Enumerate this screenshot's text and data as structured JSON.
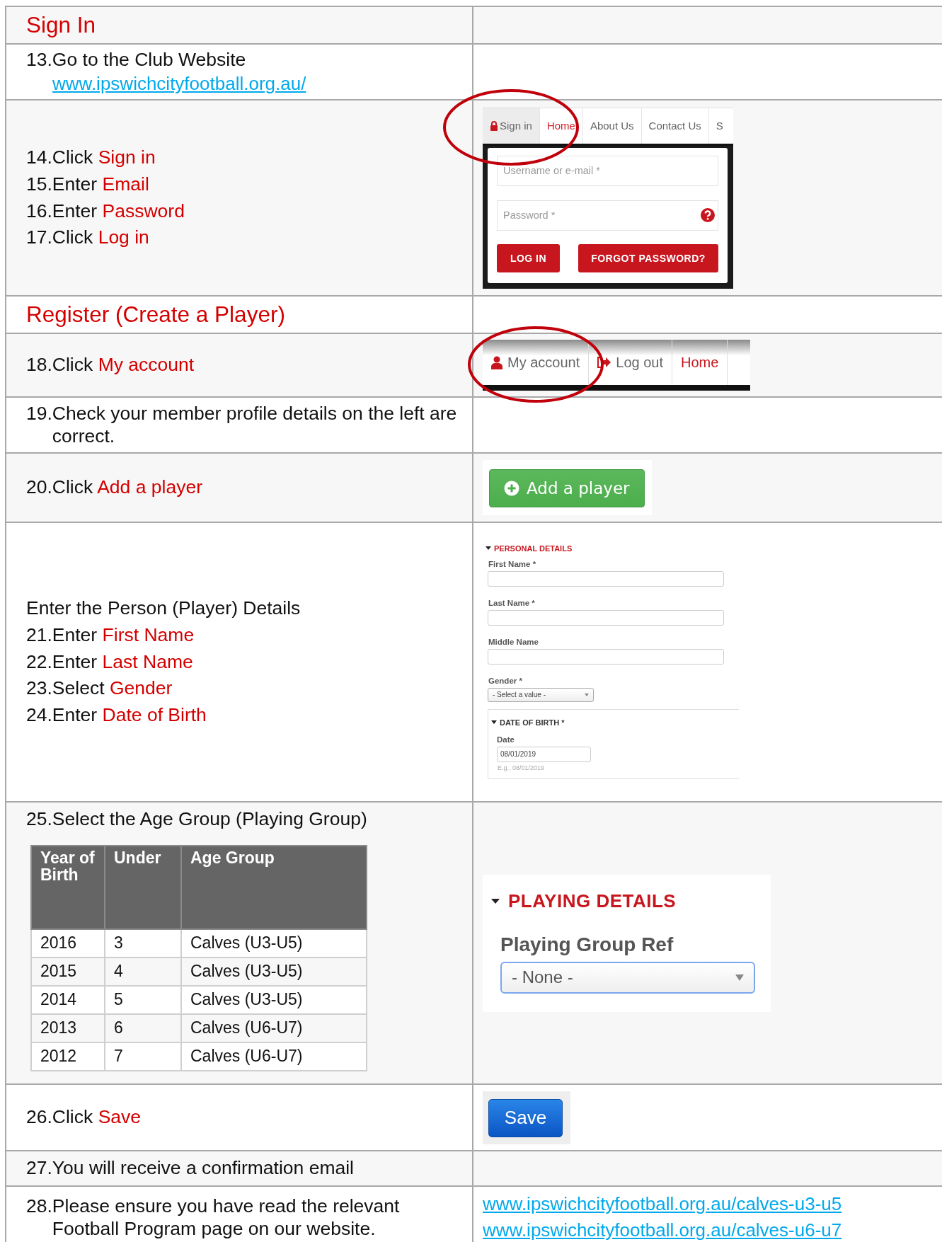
{
  "sections": [
    {
      "kind": "heading",
      "title": "Sign In"
    },
    {
      "kind": "step",
      "steps": [
        {
          "number": "13.",
          "text": "Go to the Club Website"
        }
      ],
      "link": "www.ipswichcityfootball.org.au/"
    },
    {
      "kind": "step",
      "steps": [
        {
          "number": "14.",
          "text": "Click",
          "target": "Sign in"
        },
        {
          "number": "15.",
          "text": "Enter",
          "target": "Email"
        },
        {
          "number": "16.",
          "text": "Enter",
          "target": "Password"
        },
        {
          "number": "17.",
          "text": "Click",
          "target": "Log in"
        }
      ],
      "panel": {
        "kind": "signin",
        "tabs": [
          {
            "label": "Sign in",
            "kind": "lock",
            "selected": true,
            "current": false,
            "circled": true
          },
          {
            "label": "Home",
            "kind": "plain",
            "selected": false,
            "current": true,
            "circled": false
          },
          {
            "label": "About Us",
            "kind": "plain",
            "selected": false,
            "current": false,
            "circled": false
          },
          {
            "label": "Contact Us",
            "kind": "plain",
            "selected": false,
            "current": false,
            "circled": false
          },
          {
            "label": "S",
            "kind": "plain",
            "selected": false,
            "current": false,
            "circled": false
          }
        ],
        "username_placeholder": "Username or e-mail *",
        "password_placeholder": "Password *",
        "login_button": "LOG IN",
        "forgot_button": "FORGOT PASSWORD?"
      }
    },
    {
      "kind": "heading",
      "title": "Register (Create a Player)"
    },
    {
      "kind": "step",
      "steps": [
        {
          "number": "18.",
          "text": "Click",
          "target": "My account"
        }
      ],
      "panel": {
        "kind": "account_nav",
        "items": [
          {
            "label": "My account",
            "kind": "user",
            "current": false,
            "circled": true
          },
          {
            "label": "Log out",
            "kind": "exit",
            "current": false,
            "circled": false
          },
          {
            "label": "Home",
            "kind": "plain",
            "current": true,
            "circled": false
          }
        ]
      }
    },
    {
      "kind": "step",
      "steps": [
        {
          "number": "19.",
          "text": "Check your member profile details on the left are correct."
        }
      ]
    },
    {
      "kind": "step",
      "steps": [
        {
          "number": "20.",
          "text": "Click",
          "target": "Add a player"
        }
      ],
      "panel": {
        "kind": "add_button",
        "label": "Add a player"
      }
    },
    {
      "kind": "step",
      "intro": "Enter the Person (Player) Details",
      "steps": [
        {
          "number": "21.",
          "text": "Enter",
          "target": "First Name"
        },
        {
          "number": "22.",
          "text": "Enter",
          "target": "Last Name"
        },
        {
          "number": "23.",
          "text": "Select",
          "target": "Gender"
        },
        {
          "number": "24.",
          "text": "Enter",
          "target": "Date of Birth"
        }
      ],
      "panel": {
        "kind": "personal_form",
        "title": "PERSONAL DETAILS",
        "fields": [
          {
            "label": "First Name *",
            "kind": "text"
          },
          {
            "label": "Last Name *",
            "kind": "text"
          },
          {
            "label": "Middle Name",
            "kind": "text"
          },
          {
            "label": "Gender *",
            "kind": "select",
            "value": "- Select a value -"
          }
        ],
        "date_group": {
          "title": "DATE OF BIRTH *",
          "label": "Date",
          "value": "08/01/2019",
          "hint": "E.g., 08/01/2019"
        }
      }
    },
    {
      "kind": "step",
      "steps": [
        {
          "number": "25.",
          "text": "Select the Age Group (Playing Group)"
        }
      ],
      "table": {
        "columns": [
          "Year of Birth",
          "Under",
          "Age Group"
        ],
        "rows": [
          [
            "2016",
            "3",
            "Calves (U3-U5)"
          ],
          [
            "2015",
            "4",
            "Calves (U3-U5)"
          ],
          [
            "2014",
            "5",
            "Calves (U3-U5)"
          ],
          [
            "2013",
            "6",
            "Calves (U6-U7)"
          ],
          [
            "2012",
            "7",
            "Calves (U6-U7)"
          ]
        ]
      },
      "panel": {
        "kind": "playing_details",
        "title": "PLAYING DETAILS",
        "label": "Playing Group Ref",
        "value": "- None -"
      }
    },
    {
      "kind": "step",
      "steps": [
        {
          "number": "26.",
          "text": "Click",
          "target": "Save"
        }
      ],
      "panel": {
        "kind": "save_button",
        "label": "Save"
      }
    },
    {
      "kind": "step",
      "steps": [
        {
          "number": "27.",
          "text": "You will receive a confirmation email"
        }
      ]
    },
    {
      "kind": "step",
      "steps": [
        {
          "number": "28.",
          "text": "Please ensure you have read the relevant Football Program page on our website."
        }
      ],
      "panel": {
        "kind": "links",
        "links": [
          "www.ipswichcityfootball.org.au/calves-u3-u5",
          "www.ipswichcityfootball.org.au/calves-u6-u7"
        ]
      }
    }
  ]
}
